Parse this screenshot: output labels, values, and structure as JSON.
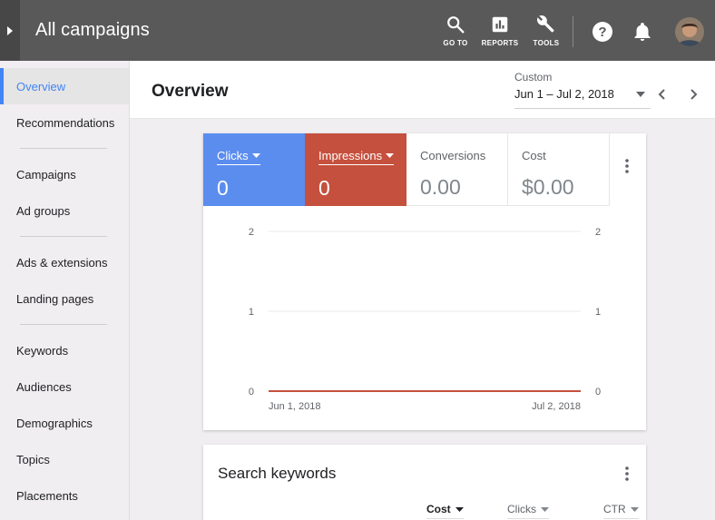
{
  "header": {
    "title": "All campaigns",
    "actions": [
      {
        "label": "GO TO",
        "icon": "search-icon"
      },
      {
        "label": "REPORTS",
        "icon": "reports-icon"
      },
      {
        "label": "TOOLS",
        "icon": "wrench-icon"
      }
    ],
    "help_icon": "help-icon",
    "notifications_icon": "bell-icon",
    "avatar_icon": "user-avatar"
  },
  "sidebar": {
    "items": [
      {
        "label": "Overview",
        "active": true
      },
      {
        "label": "Recommendations"
      },
      {
        "label": "Campaigns"
      },
      {
        "label": "Ad groups"
      },
      {
        "label": "Ads & extensions"
      },
      {
        "label": "Landing pages"
      },
      {
        "label": "Keywords"
      },
      {
        "label": "Audiences"
      },
      {
        "label": "Demographics"
      },
      {
        "label": "Topics"
      },
      {
        "label": "Placements"
      }
    ]
  },
  "page": {
    "title": "Overview",
    "date_type": "Custom",
    "date_range": "Jun 1 – Jul 2, 2018"
  },
  "metrics": [
    {
      "name": "Clicks",
      "value": "0",
      "color": "#5b8def"
    },
    {
      "name": "Impressions",
      "value": "0",
      "color": "#c5503d"
    },
    {
      "name": "Conversions",
      "value": "0.00"
    },
    {
      "name": "Cost",
      "value": "$0.00"
    }
  ],
  "chart_data": {
    "type": "line",
    "x": [
      "Jun 1, 2018",
      "Jul 2, 2018"
    ],
    "x_tick_labels": [
      "Jun 1, 2018",
      "Jul 2, 2018"
    ],
    "y_ticks_left": [
      "0",
      "1",
      "2"
    ],
    "y_ticks_right": [
      "0",
      "1",
      "2"
    ],
    "ylim": [
      0,
      2
    ],
    "series": [
      {
        "values": [
          0,
          0
        ],
        "color": "#5b8def"
      },
      {
        "values": [
          0,
          0
        ],
        "color": "#c5503d"
      }
    ],
    "grid": true
  },
  "keywords": {
    "title": "Search keywords",
    "columns": [
      {
        "label": "Cost",
        "sorted": true
      },
      {
        "label": "Clicks"
      },
      {
        "label": "CTR"
      }
    ]
  }
}
